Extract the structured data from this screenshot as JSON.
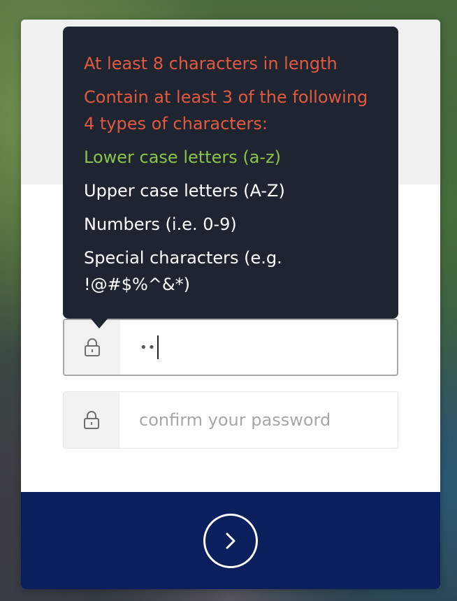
{
  "password_rules": {
    "length_rule": "At least 8 characters in length",
    "types_rule": "Contain at least 3 of the following 4 types of characters:",
    "lower": "Lower case letters (a-z)",
    "upper": "Upper case letters (A-Z)",
    "numbers": "Numbers (i.e. 0-9)",
    "special": "Special characters (e.g. !@#$%^&*)"
  },
  "password_field": {
    "masked_value": "••",
    "icon": "lock-icon"
  },
  "confirm_field": {
    "placeholder": "confirm your password",
    "icon": "lock-icon"
  },
  "submit": {
    "icon": "chevron-right-icon"
  },
  "colors": {
    "fail": "#e05a40",
    "pass": "#8bc34a",
    "tooltip_bg": "#1f2431",
    "footer_bg": "#0b1f5c"
  }
}
